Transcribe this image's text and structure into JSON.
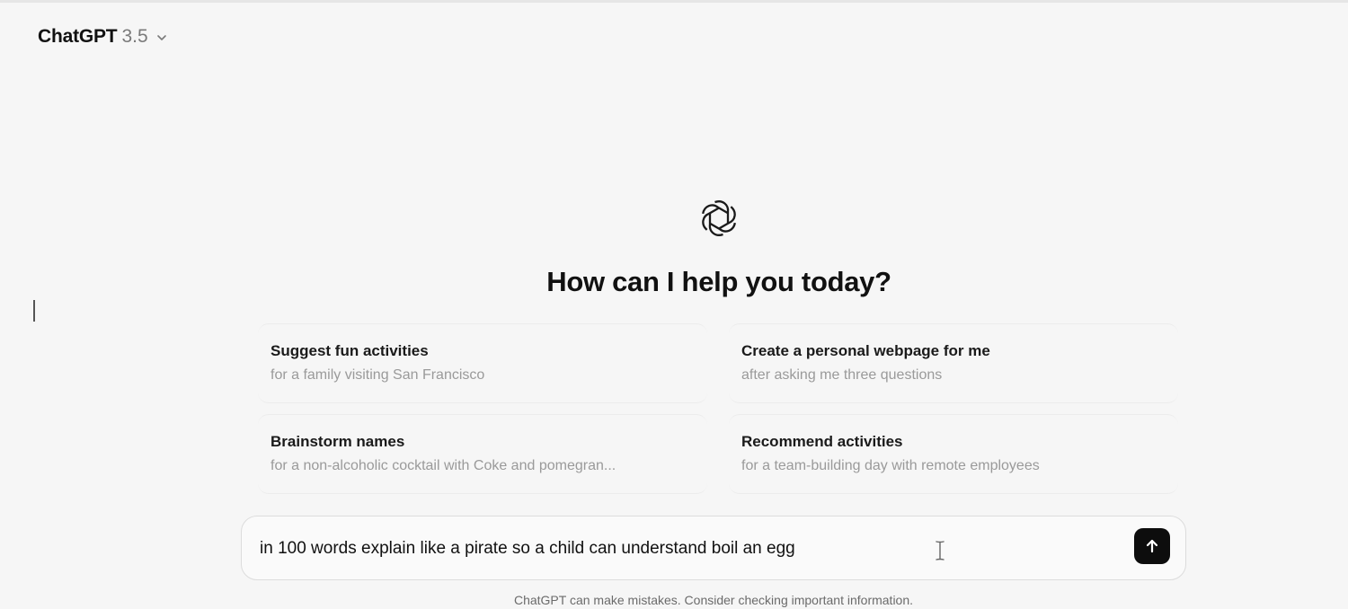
{
  "header": {
    "model_name": "ChatGPT",
    "model_version": "3.5",
    "chevron_icon": "chevron-down-icon"
  },
  "main": {
    "logo_icon": "openai-logo-icon",
    "headline": "How can I help you today?",
    "suggestions": [
      {
        "title": "Suggest fun activities",
        "subtitle": "for a family visiting San Francisco"
      },
      {
        "title": "Create a personal webpage for me",
        "subtitle": "after asking me three questions"
      },
      {
        "title": "Brainstorm names",
        "subtitle": "for a non-alcoholic cocktail with Coke and pomegran..."
      },
      {
        "title": "Recommend activities",
        "subtitle": "for a team-building day with remote employees"
      }
    ]
  },
  "composer": {
    "value": "in 100 words explain like a pirate so a child can understand boil an egg",
    "send_icon": "arrow-up-icon"
  },
  "footer": {
    "disclaimer": "ChatGPT can make mistakes. Consider checking important information."
  },
  "colors": {
    "background": "#f6f6f6",
    "send_button": "#0d0d0d",
    "muted_text": "#9a9a9a"
  }
}
